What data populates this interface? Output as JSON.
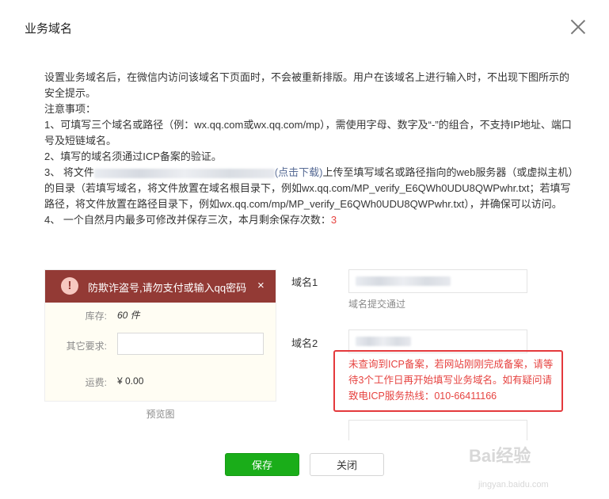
{
  "dialog": {
    "title": "业务域名"
  },
  "description": {
    "line1": "设置业务域名后，在微信内访问该域名下页面时，不会被重新排版。用户在该域名上进行输入时，不出现下图所示的安全提示。",
    "notice_title": "注意事项：",
    "item1": "1、可填写三个域名或路径（例：wx.qq.com或wx.qq.com/mp），需使用字母、数字及“-”的组合，不支持IP地址、端口号及短链域名。",
    "item2": "2、填写的域名须通过ICP备案的验证。",
    "item3_prefix": "3、 将文件",
    "item3_link": "(点击下载)",
    "item3_suffix": "上传至填写域名或路径指向的web服务器（或虚拟主机）的目录（若填写域名，将文件放置在域名根目录下，例如wx.qq.com/MP_verify_E6QWh0UDU8QWPwhr.txt；若填写路径，将文件放置在路径目录下，例如wx.qq.com/mp/MP_verify_E6QWh0UDU8QWPwhr.txt），并确保可以访问。",
    "item4_prefix": "4、 一个自然月内最多可修改并保存三次，本月剩余保存次数：",
    "item4_count": "3"
  },
  "preview": {
    "warning_text": "防欺诈盗号,请勿支付或输入qq密码",
    "warning_icon": "!",
    "close_glyph": "×",
    "stock_label": "库存:",
    "stock_value": "60 件",
    "other_label": "其它要求:",
    "shipping_label": "运费:",
    "shipping_value": "¥ 0.00",
    "caption": "预览图"
  },
  "form": {
    "domain1_label": "域名1",
    "domain1_hint": "域名提交通过",
    "domain2_label": "域名2",
    "error_message": "未查询到ICP备案，若网站刚刚完成备案，请等待3个工作日再开始填写业务域名。如有疑问请致电ICP服务热线：010-66411166"
  },
  "buttons": {
    "save": "保存",
    "close": "关闭"
  },
  "watermark": {
    "main": "Bai经验",
    "sub": "jingyan.baidu.com"
  },
  "colors": {
    "primary": "#1aad19",
    "warning_bar": "#933a35",
    "error": "#e64340",
    "link": "#576b95"
  }
}
